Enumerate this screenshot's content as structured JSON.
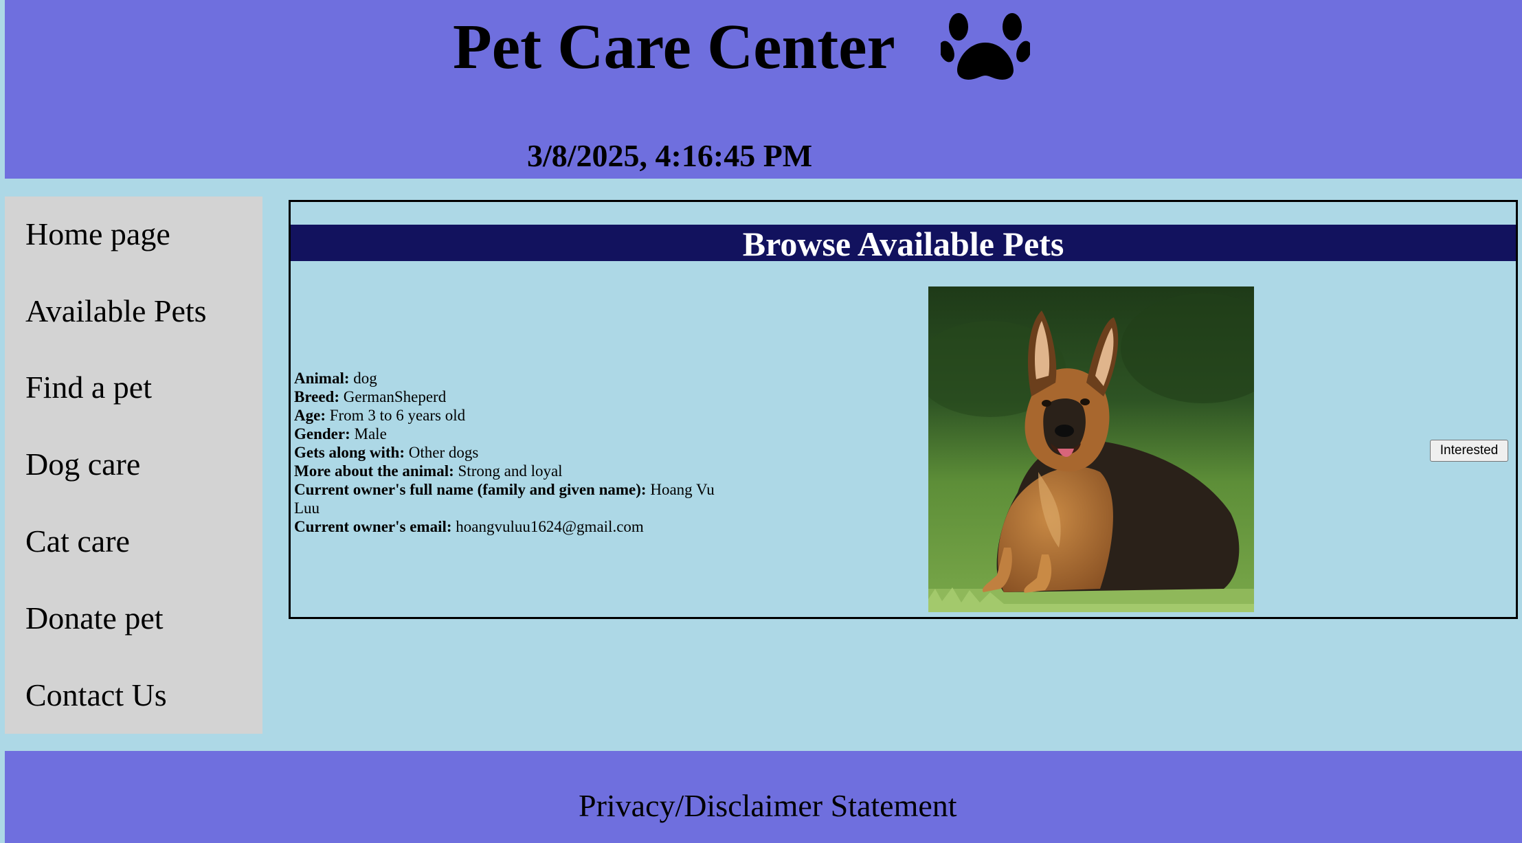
{
  "header": {
    "title": "Pet Care Center",
    "logo_icon": "paw-icon",
    "datetime": "3/8/2025, 4:16:45 PM"
  },
  "sidebar": {
    "items": [
      {
        "label": "Home page"
      },
      {
        "label": "Available Pets"
      },
      {
        "label": "Find a pet"
      },
      {
        "label": "Dog care"
      },
      {
        "label": "Cat care"
      },
      {
        "label": "Donate pet"
      },
      {
        "label": "Contact Us"
      }
    ]
  },
  "main": {
    "heading": "Browse Available Pets",
    "pet": {
      "animal_label": "Animal:",
      "animal": "dog",
      "breed_label": "Breed:",
      "breed": "GermanSheperd",
      "age_label": "Age:",
      "age": "From 3 to 6 years old",
      "gender_label": "Gender:",
      "gender": "Male",
      "gets_along_label": "Gets along with:",
      "gets_along": "Other dogs",
      "more_label": "More about the animal:",
      "more": "Strong and loyal",
      "owner_name_label": "Current owner's full name (family and given name):",
      "owner_name": "Hoang Vu Luu",
      "owner_email_label": "Current owner's email:",
      "owner_email": "hoangvuluu1624@gmail.com",
      "photo_icon": "german-shepherd-photo"
    },
    "interested_button": "Interested"
  },
  "footer": {
    "link": "Privacy/Disclaimer Statement"
  },
  "colors": {
    "page_bg": "#add8e6",
    "header_bg": "#6f6fde",
    "sidebar_bg": "#d3d3d3",
    "heading_bg": "#12125e",
    "heading_text": "#ffffff"
  }
}
